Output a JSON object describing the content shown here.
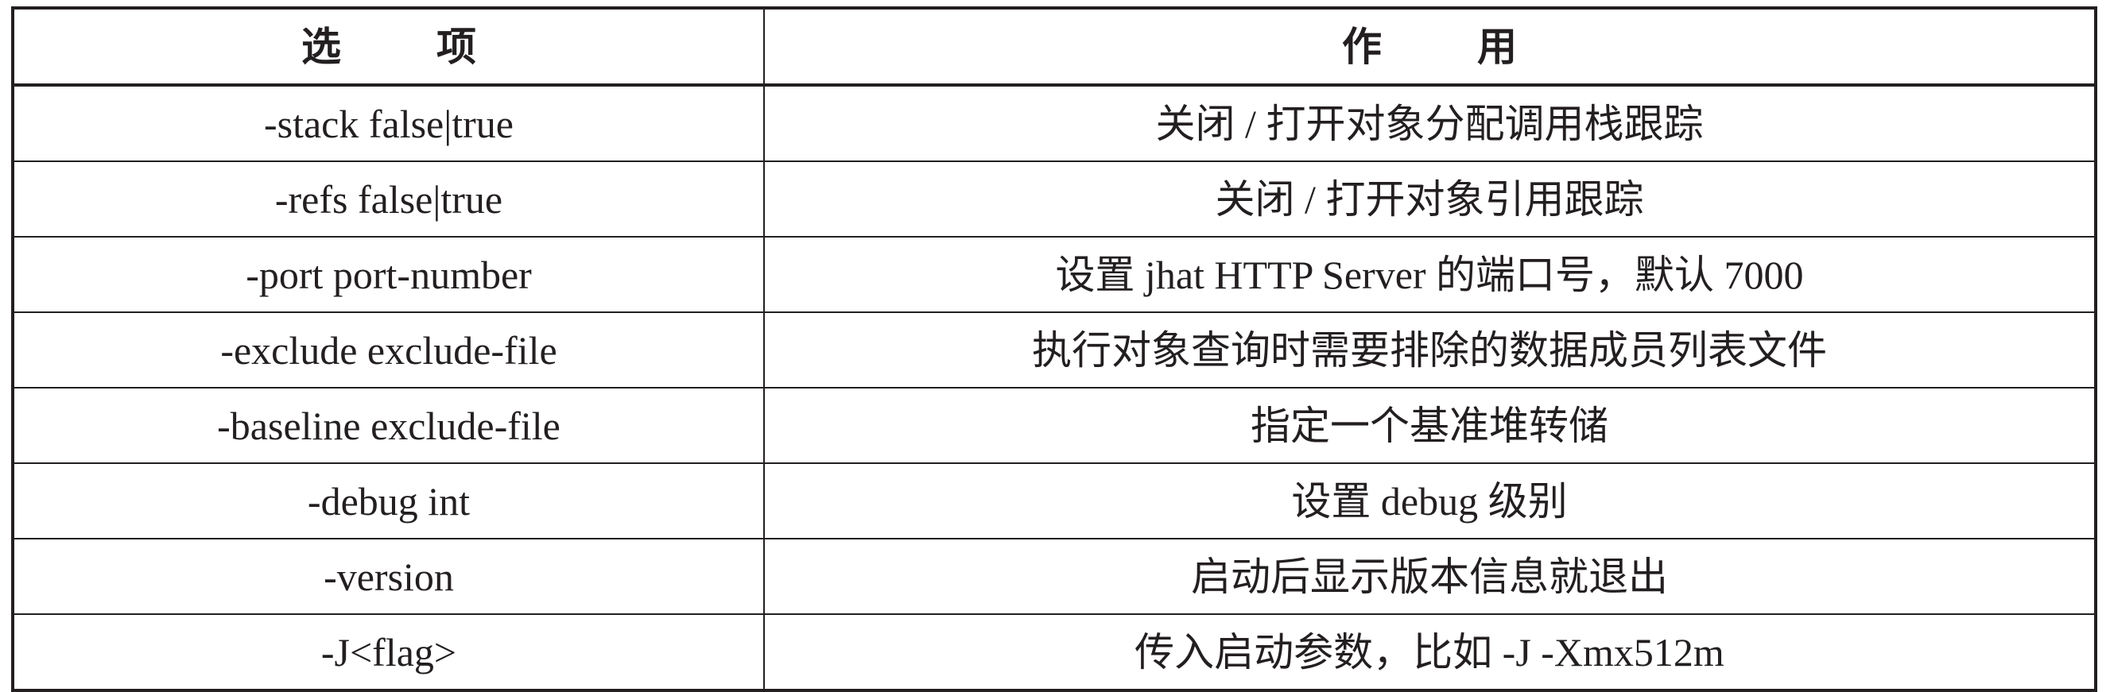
{
  "table": {
    "headers": {
      "option": [
        "选",
        "项"
      ],
      "purpose": [
        "作",
        "用"
      ]
    },
    "rows": [
      {
        "option": "-stack  false|true",
        "purpose": "关闭 / 打开对象分配调用栈跟踪"
      },
      {
        "option": "-refs  false|true",
        "purpose": "关闭 / 打开对象引用跟踪"
      },
      {
        "option": "-port  port-number",
        "purpose": "设置 jhat HTTP Server 的端口号，默认 7000"
      },
      {
        "option": "-exclude  exclude-file",
        "purpose": "执行对象查询时需要排除的数据成员列表文件"
      },
      {
        "option": "-baseline  exclude-file",
        "purpose": "指定一个基准堆转储"
      },
      {
        "option": "-debug  int",
        "purpose": "设置 debug 级别"
      },
      {
        "option": "-version",
        "purpose": "启动后显示版本信息就退出"
      },
      {
        "option": "-J<flag>",
        "purpose": "传入启动参数，比如 -J -Xmx512m"
      }
    ]
  }
}
